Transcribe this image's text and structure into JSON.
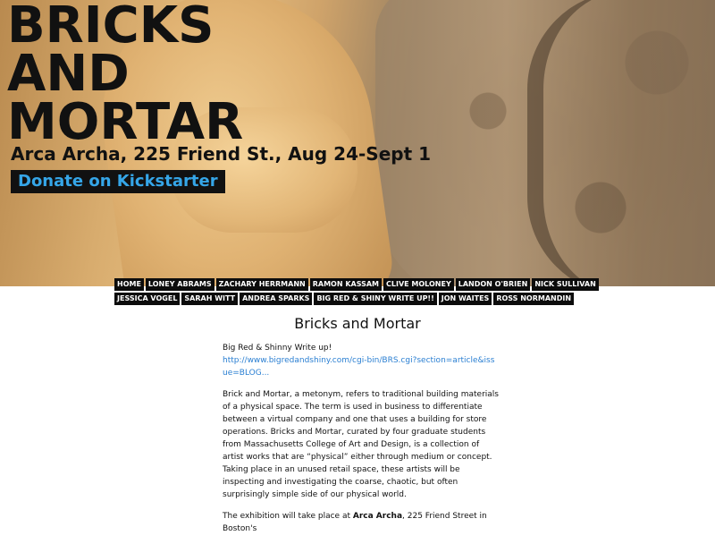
{
  "hero": {
    "title_line1": "BRICKS",
    "title_line2": "AND",
    "title_line3": "MORTAR",
    "subtitle": "Arca Archa, 225 Friend St., Aug 24-Sept 1",
    "donate_label": "Donate on Kickstarter",
    "donate_color": "#35a6e8"
  },
  "nav": {
    "items": [
      "HOME",
      "LONEY ABRAMS",
      "ZACHARY HERRMANN",
      "RAMON KASSAM",
      "CLIVE MOLONEY",
      "LANDON O'BRIEN",
      "NICK SULLIVAN",
      "JESSICA VOGEL",
      "SARAH WITT",
      "ANDREA SPARKS",
      "BIG RED & SHINY WRITE UP!!",
      "JON WAITES",
      "ROSS NORMANDIN"
    ]
  },
  "page": {
    "title": "Bricks and Mortar"
  },
  "post": {
    "intro": "Big Red & Shinny Write up!",
    "link": "http://www.bigredandshiny.com/cgi-bin/BRS.cgi?section=article&issue=BLOG...",
    "paragraph1": "Brick and Mortar, a metonym, refers to traditional building materials of a physical space. The term is used in business to differentiate between a virtual company and one that uses a building for store operations. Bricks and Mortar, curated by four graduate students from Massachusetts College of Art and Design, is a collection of artist works that are “physical” either through medium or concept. Taking place in an unused retail space, these artists will be inspecting and investigating the coarse, chaotic, but often surprisingly simple side of our physical world.",
    "paragraph2_start": "The exhibition will take place at ",
    "paragraph2_bold": "Arca Archa",
    "paragraph2_end": ", 225 Friend Street in Boston's"
  }
}
